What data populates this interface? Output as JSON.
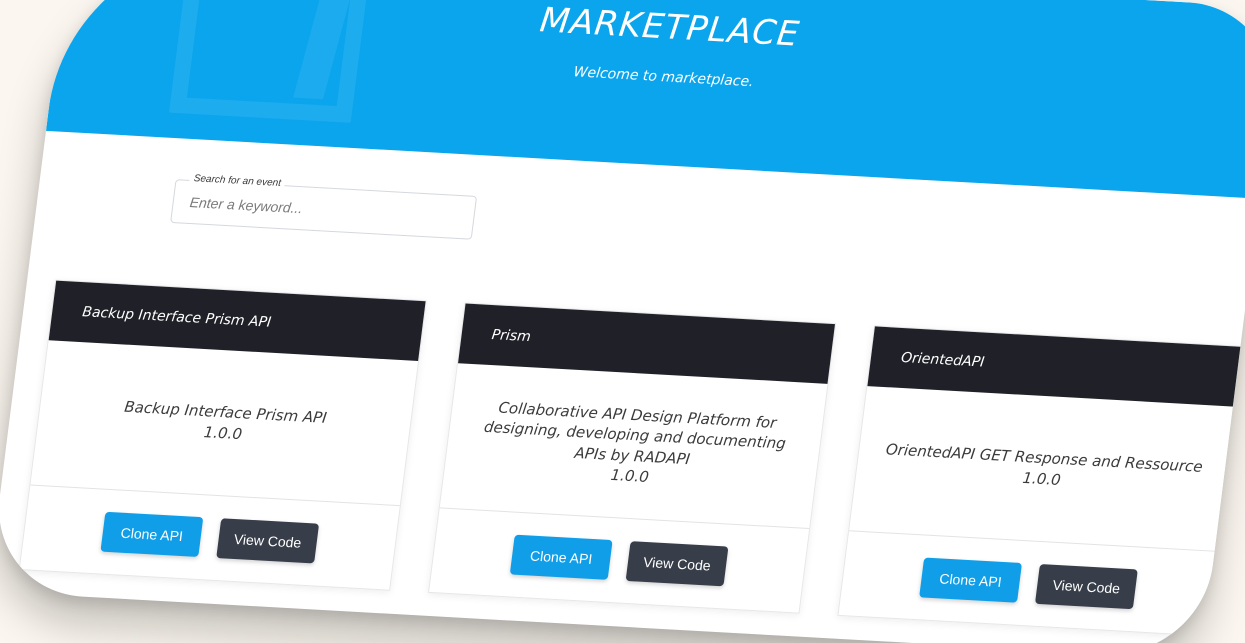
{
  "hero": {
    "title": "MARKETPLACE",
    "subtitle": "Welcome to marketplace."
  },
  "search": {
    "label": "Search for an event",
    "placeholder": "Enter a keyword..."
  },
  "cards": [
    {
      "header": "Backup Interface Prism API",
      "description": "Backup Interface Prism API",
      "version": "1.0.0",
      "clone_label": "Clone API",
      "code_label": "View Code"
    },
    {
      "header": "Prism",
      "description": "Collaborative API Design Platform for designing, developing and documenting APIs by RADAPI",
      "version": "1.0.0",
      "clone_label": "Clone API",
      "code_label": "View Code"
    },
    {
      "header": "OrientedAPI",
      "description": "OrientedAPI GET Response and Ressource",
      "version": "1.0.0",
      "clone_label": "Clone API",
      "code_label": "View Code"
    }
  ],
  "colors": {
    "primary": "#0aa5ed",
    "dark": "#202128",
    "button_dark": "#373d49"
  }
}
